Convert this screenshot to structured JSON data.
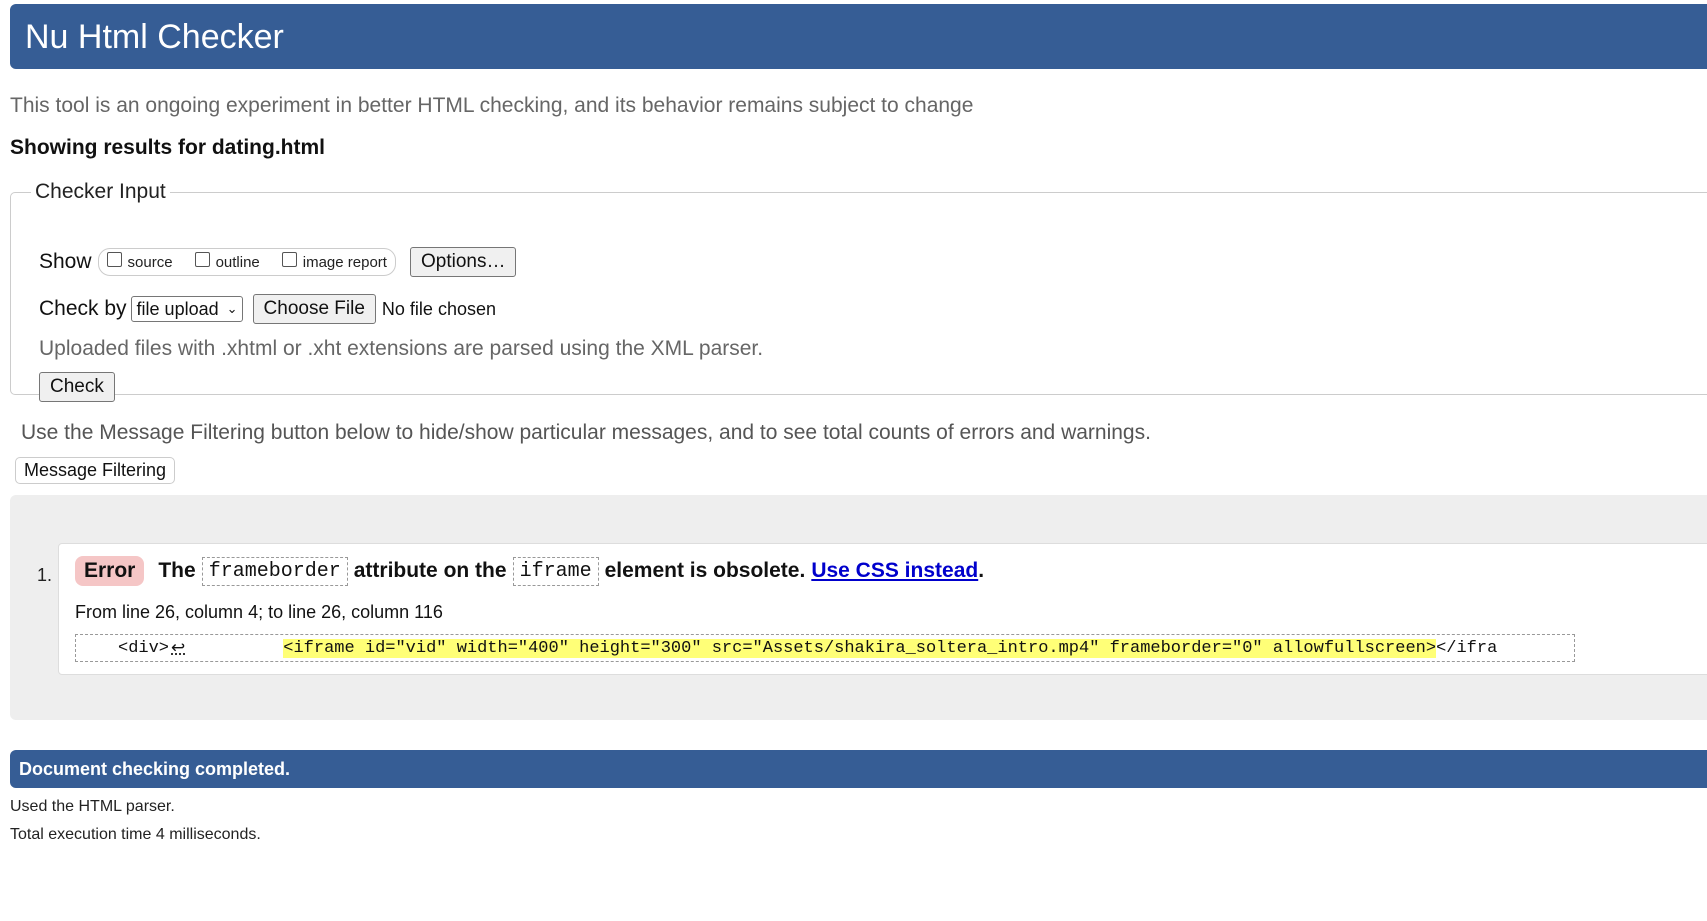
{
  "header": {
    "title": "Nu Html Checker"
  },
  "subtitle": "This tool is an ongoing experiment in better HTML checking, and its behavior remains subject to change",
  "results_for": "Showing results for dating.html",
  "checker": {
    "legend": "Checker Input",
    "show_label": "Show",
    "checkboxes": [
      {
        "label": "source",
        "checked": false
      },
      {
        "label": "outline",
        "checked": false
      },
      {
        "label": "image report",
        "checked": false
      }
    ],
    "options_label": "Options…",
    "check_by_label": "Check by",
    "check_by_value": "file upload",
    "choose_file_label": "Choose File",
    "no_file_text": "No file chosen",
    "upload_note": "Uploaded files with .xhtml or .xht extensions are parsed using the XML parser.",
    "check_label": "Check"
  },
  "filter_note": "Use the Message Filtering button below to hide/show particular messages, and to see total counts of errors and warnings.",
  "message_filtering_label": "Message Filtering",
  "messages": [
    {
      "number": "1.",
      "type": "Error",
      "text_1": "The",
      "code_1": "frameborder",
      "text_2": "attribute on the",
      "code_2": "iframe",
      "text_3": "element is obsolete.",
      "link_text": "Use CSS instead",
      "text_end": ".",
      "location": "From line 26, column 4; to line 26, column 116",
      "extract_before": "<div>",
      "extract_return": "↩",
      "extract_highlight": "<iframe id=\"vid\" width=\"400\" height=\"300\" src=\"Assets/shakira_soltera_intro.mp4\" frameborder=\"0\" allowfullscreen>",
      "extract_after": "</ifra"
    }
  ],
  "done": "Document checking completed.",
  "footer": {
    "parser": "Used the HTML parser.",
    "time": "Total execution time 4 milliseconds."
  },
  "colors": {
    "header_bg": "#365d95",
    "error_badge": "#f5c6c6",
    "highlight": "#ffff77",
    "link": "#0000cc"
  }
}
